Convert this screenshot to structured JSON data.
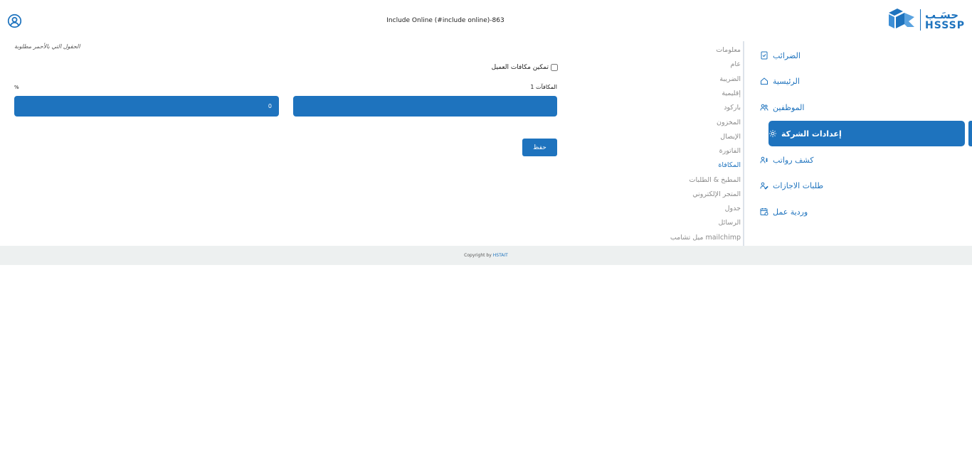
{
  "header": {
    "title": "Include Online (#include online)-863",
    "logo_ar": "حسَـب",
    "logo_en": "HSSSP"
  },
  "sidebar": {
    "items": [
      {
        "label": "الضرائب",
        "icon": "receipt-icon"
      },
      {
        "label": "الرئيسية",
        "icon": "home-icon"
      },
      {
        "label": "الموظفين",
        "icon": "users-icon"
      },
      {
        "label": "إعدادات الشركة",
        "icon": "gear-icon",
        "active": true
      },
      {
        "label": "كشف رواتب",
        "icon": "payroll-icon"
      },
      {
        "label": "طلبات الاجازات",
        "icon": "leave-request-icon"
      },
      {
        "label": "وردية عمل",
        "icon": "shift-calendar-icon"
      }
    ]
  },
  "submenu": {
    "items": [
      "معلومات",
      "عام",
      "الضريبة",
      "إقليمية",
      "باركود",
      "المخزون",
      "الإيصال",
      "الفاتورة",
      "المكافاة",
      "المطبخ & الطلبات",
      "المتجر الإلكتروني",
      "جدول",
      "الرسائل",
      "mailchimp ميل تشامب"
    ],
    "current": "المكافاة"
  },
  "form": {
    "required_note": "الحقول التي بالأحمر مطلوبة",
    "enable_rewards_label": "تمكين مكافات العميل",
    "enable_rewards_checked": false,
    "rewards_label": "المكافآت 1",
    "percent_label": "%",
    "rewards_value": "",
    "percent_value": "0",
    "save_label": "حفظ"
  },
  "footer": {
    "copyright": "Copyright by",
    "brand": "HSTAIT"
  },
  "colors": {
    "accent": "#1e73be",
    "footer_bg": "#edf0f0",
    "submenu_text": "#8c8c8c"
  }
}
